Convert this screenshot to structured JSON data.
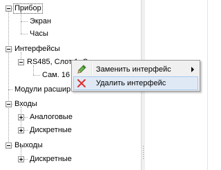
{
  "tree": {
    "nodes": [
      {
        "label": "Прибор",
        "selected": true
      },
      {
        "label": "Экран"
      },
      {
        "label": "Часы"
      },
      {
        "label": "Интерфейсы"
      },
      {
        "label": "RS485, Слот 1, Су"
      },
      {
        "label": "Сам. 16"
      },
      {
        "label": "Модули расшир"
      },
      {
        "label": "Входы"
      },
      {
        "label": "Аналоговые"
      },
      {
        "label": "Дискретные"
      },
      {
        "label": "Выходы"
      },
      {
        "label": "Дискретные"
      }
    ]
  },
  "context_menu": {
    "items": [
      {
        "label": "Заменить интерфейс",
        "icon": "pencil-icon",
        "has_submenu": true
      },
      {
        "label": "Удалить интерфейс",
        "icon": "red-x-icon",
        "highlighted": true
      }
    ]
  },
  "colors": {
    "menu_background": "#f0f0f0",
    "menu_highlight": "#dfe9f5",
    "menu_highlight_border": "#a8c8eb",
    "delete_icon": "#e03030",
    "pencil_icon": "#4f9b3e"
  }
}
